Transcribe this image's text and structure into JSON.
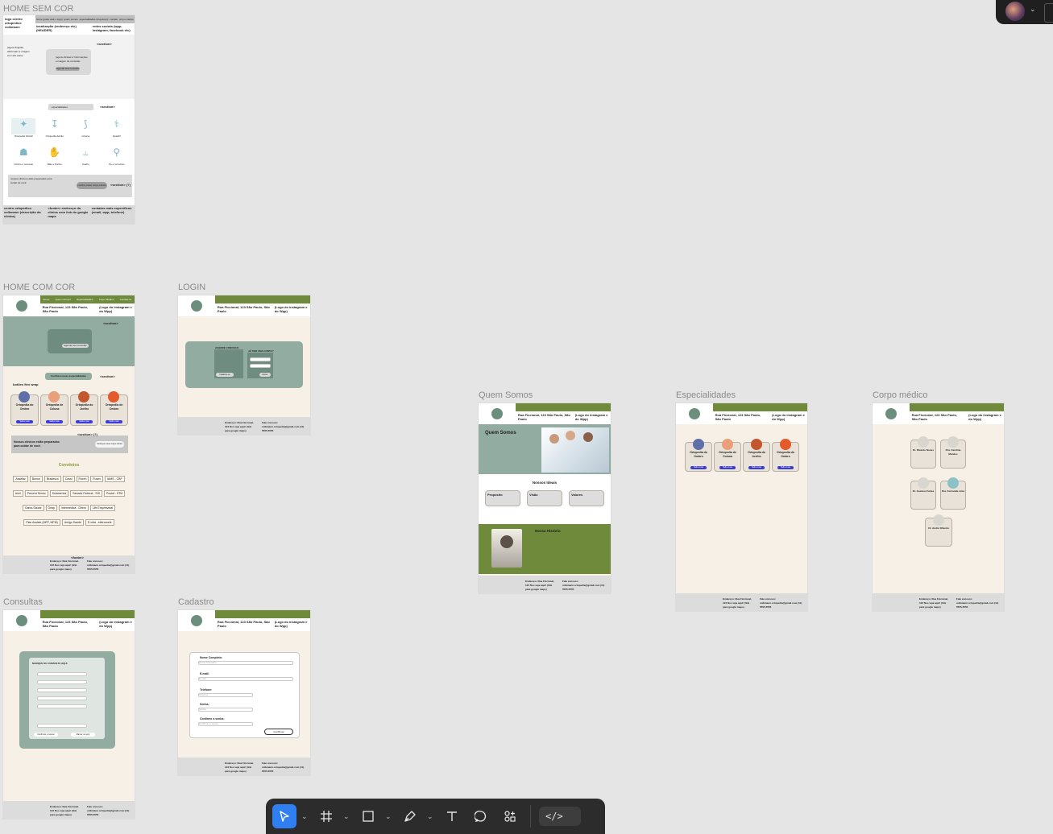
{
  "frames": {
    "home_sem_cor": {
      "label": "HOME SEM COR",
      "header_cols": [
        "logo centro ortopedico volkmann",
        "localização (endereço etc) (HEADER)",
        "redes sociais (wpp, instagram, facebook etc)"
      ],
      "nav_items": [
        "home (pode usar o logo)",
        "quem somos",
        "especialidades (dropdown)",
        "contato",
        "corpo médico"
      ],
      "section1_left": "(agora dirigido) adiconado a imagem com alto efeito",
      "section1_box": "(agora clicavel c/ informações e imagem de consulta)",
      "section1_btn": "agende sua consulta",
      "section_tag": "<section>",
      "section2_pill": "especialidades",
      "section2_tag": "<section>",
      "icons": [
        "Ortopedia Infantil",
        "Ortopedia Adulto",
        "Coluna",
        "Quadril",
        "Ombro e cotovelo",
        "Mão e Punho",
        "Joelho",
        "Pé e tornozelo"
      ],
      "section3_text": "nossos clínicos estão preparados para cuidar de você",
      "section3_btn": "confira nosso corpo clínico",
      "section3_tag": "<section> (?)",
      "footer_left": "centro ortopedico volkmann (descrição da clínica)",
      "footer_mid": "<footer> endereço da clínica com link do google maps",
      "footer_right": "contatos mais específicos (email, wpp, telefone)"
    },
    "home_com_cor": {
      "label": "HOME COM COR",
      "header_tag": "(HEADER)",
      "address": "Rua Ficcional, 123 São Paulo, São Paulo",
      "social": "(Logo do instagram e do Wpp)",
      "nav_items": [
        "Home",
        "Quem somos?",
        "Especialidades",
        "Corpo Médico",
        "Contate-se"
      ],
      "section_tag": "<section>",
      "hero_btn": "Agende sua consulta!",
      "spec_pill": "Confira nossas especialidades",
      "spec_tag": "<section>",
      "flex_label": "botões flex wrap",
      "spec_cards": [
        "Ortopedia do Ombro",
        "Ortopedia de Coluna",
        "Ortopedia do Joelho",
        "Ortopedia de Ombro"
      ],
      "spec_btn": "Saiba mais",
      "team_text": "Nossos clínicos estão preparados para cuidar de você.",
      "team_tag": "<section> (?)",
      "team_btn": "Conheça nosso corpo clínico",
      "conv_title": "Convênios",
      "convenios": [
        "Assefaz",
        "Bunun",
        "Bradesco",
        "Cassi",
        "Fioreh",
        "Fusex",
        "IAMS - CBF",
        "Amil",
        "Prevent Senior",
        "Sulamerica",
        "Senado Federal - SIS",
        "Postal - STM",
        "Gama Saúde",
        "Geap",
        "Intermédica - Direm",
        "Life Empresarial",
        "Plan Assiste (MPF, MPM)",
        "Amigo Saúde",
        "E-vida - eletronorte"
      ],
      "footer_tag": "<footer>",
      "footer_addr": "Endereço: Rua Ficcional, 123 Nos veja aqui! (link para google maps)",
      "footer_contact": "Fale conosco: volkmann.ortopedia@gmail.com (11) 5555-5555"
    },
    "login": {
      "label": "LOGIN",
      "left_title": "AGENDE CONOSCO",
      "right_title": "JÁ TEM UMA CONTA?",
      "btn_left": "Cadastre-se",
      "btn_right": "Entrar"
    },
    "quem_somos": {
      "label": "Quem Somos",
      "title": "Quem Somos",
      "ideais_title": "Nossos Ideais",
      "ideais": [
        "Propósito",
        "Visão",
        "Valores"
      ],
      "historia_title": "Nossa História"
    },
    "especialidades": {
      "label": "Especialidades",
      "cards": [
        "Ortopedia do Ombro",
        "Ortopedia de Coluna",
        "Ortopedia do Joelho",
        "Ortopedia do Ombro"
      ]
    },
    "corpo_medico": {
      "label": "Corpo médico",
      "doctors": [
        "Dr. Ricardo Nunes",
        "Dra. Carolina Mendes",
        "Dr. Gustavo Farias",
        "Dra. Fernanda Lima",
        "Dr. André Oliveira"
      ]
    },
    "consultas": {
      "label": "Consultas",
      "title": "MARQUE SU CONSULTA AQUI",
      "btn_confirm": "Confirmar e marcar",
      "btn_wpp": "Marcar no wpp"
    },
    "cadastro": {
      "label": "Cadastro",
      "fields": [
        "Nome Completo:",
        "E-mail:",
        "Telefone:",
        "Senha:",
        "Confirme a senha:"
      ],
      "placeholders": [
        "Nome Completo",
        "E-mail",
        "Telefone",
        "Senha",
        "Confirme a senha"
      ],
      "btn": "Confirmar"
    }
  },
  "toolbar": {
    "tools": [
      "move-tool",
      "frame-tool",
      "shape-tool",
      "pen-tool",
      "text-tool",
      "comment-tool",
      "actions-tool",
      "dev-mode-toggle"
    ]
  },
  "colors": {
    "canvas": "#e5e5e5",
    "green": "#6e8a3a",
    "teal": "#93aca1",
    "cream": "#f7f0e6",
    "toolbar": "#2c2c2c",
    "accent": "#2f7ff1"
  }
}
